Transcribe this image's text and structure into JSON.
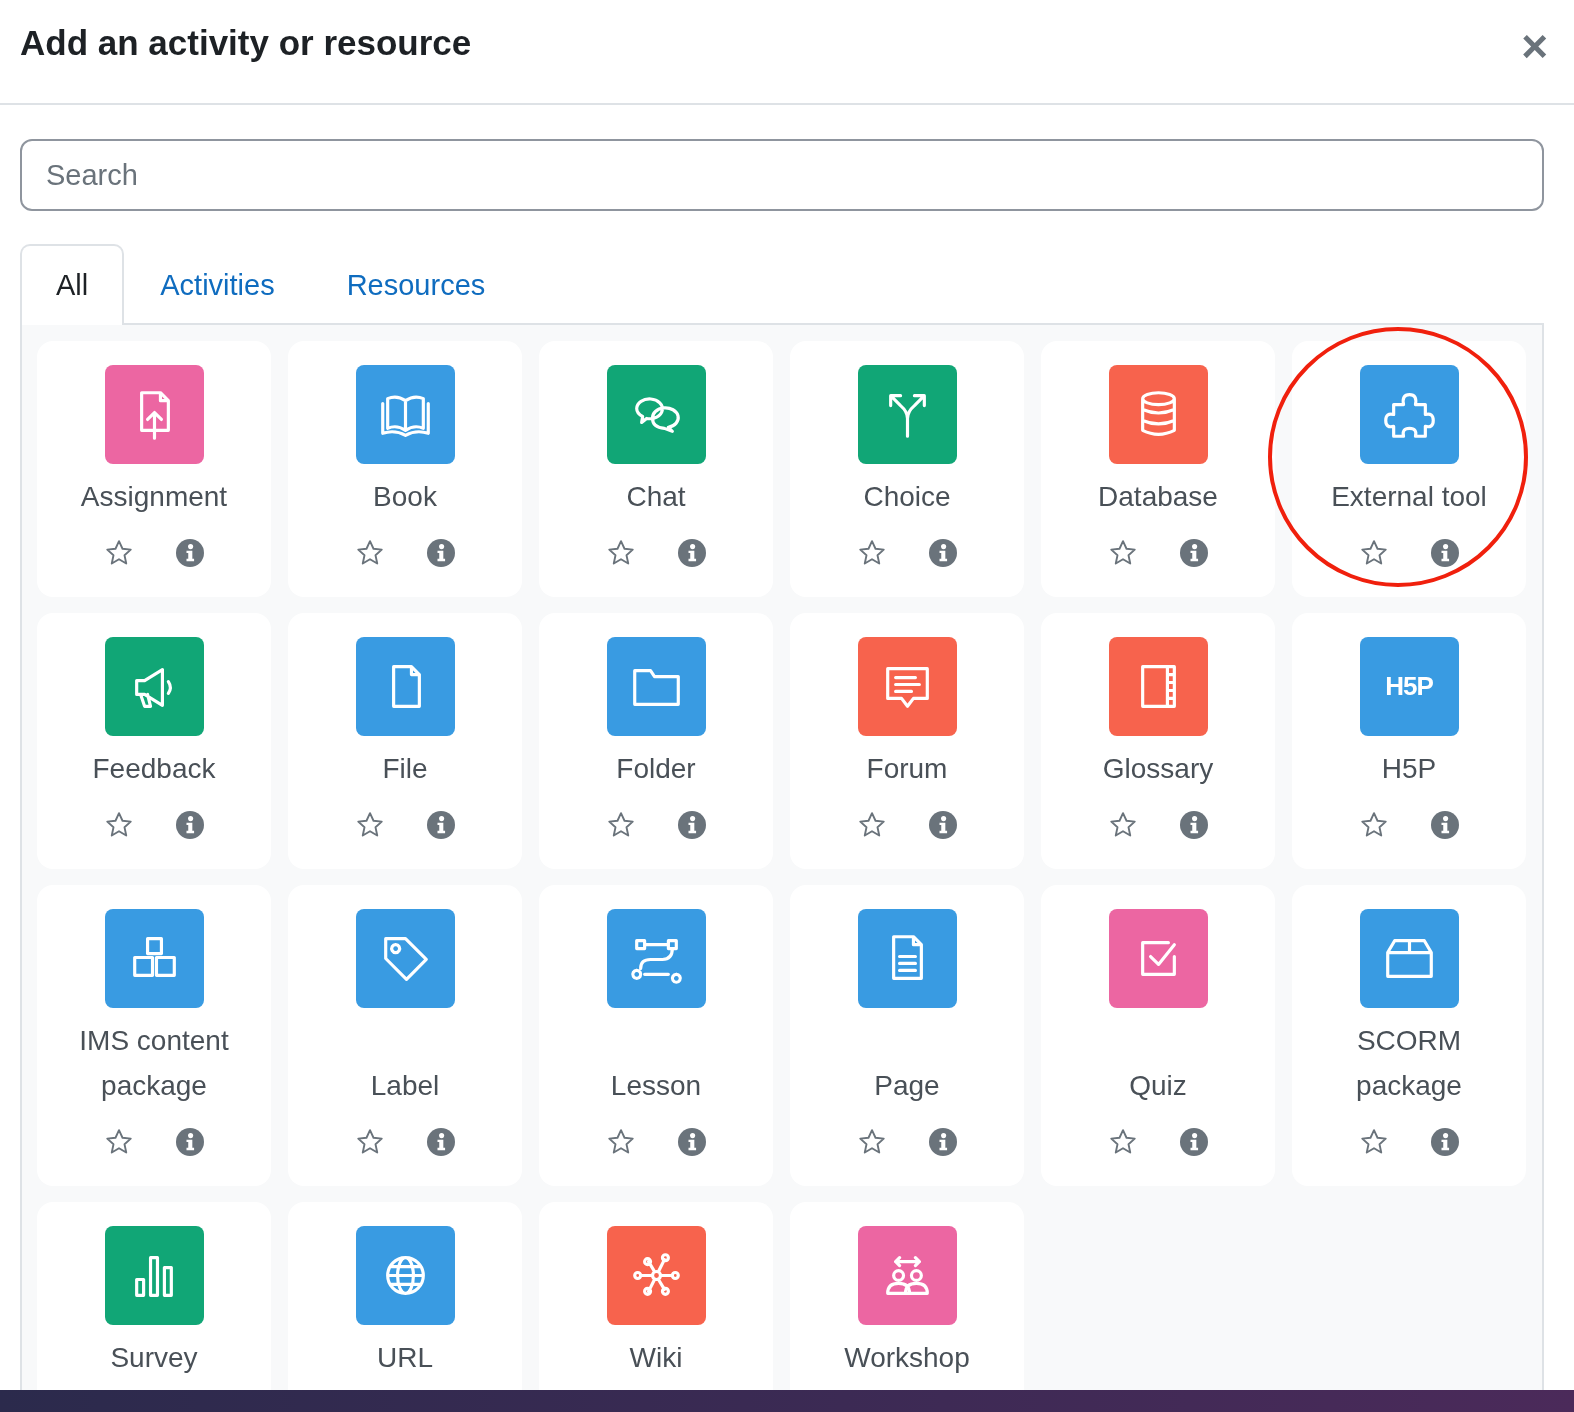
{
  "dialog": {
    "title": "Add an activity or resource",
    "close": "×"
  },
  "search": {
    "placeholder": "Search"
  },
  "tabs": [
    {
      "label": "All",
      "selected": true
    },
    {
      "label": "Activities",
      "selected": false
    },
    {
      "label": "Resources",
      "selected": false
    }
  ],
  "items": [
    {
      "name": "Assignment",
      "color": "#ec66a2",
      "highlighted": false,
      "show_actions": true
    },
    {
      "name": "Book",
      "color": "#399be2",
      "highlighted": false,
      "show_actions": true
    },
    {
      "name": "Chat",
      "color": "#11a676",
      "highlighted": false,
      "show_actions": true
    },
    {
      "name": "Choice",
      "color": "#11a676",
      "highlighted": false,
      "show_actions": true
    },
    {
      "name": "Database",
      "color": "#f7634d",
      "highlighted": false,
      "show_actions": true
    },
    {
      "name": "External tool",
      "color": "#399be2",
      "highlighted": true,
      "show_actions": true
    },
    {
      "name": "Feedback",
      "color": "#11a676",
      "highlighted": false,
      "show_actions": true
    },
    {
      "name": "File",
      "color": "#399be2",
      "highlighted": false,
      "show_actions": true
    },
    {
      "name": "Folder",
      "color": "#399be2",
      "highlighted": false,
      "show_actions": true
    },
    {
      "name": "Forum",
      "color": "#f7634d",
      "highlighted": false,
      "show_actions": true
    },
    {
      "name": "Glossary",
      "color": "#f7634d",
      "highlighted": false,
      "show_actions": true
    },
    {
      "name": "H5P",
      "color": "#399be2",
      "highlighted": false,
      "show_actions": true,
      "icon_text": "H5P"
    },
    {
      "name": "IMS content package",
      "color": "#399be2",
      "highlighted": false,
      "show_actions": true
    },
    {
      "name": "Label",
      "color": "#399be2",
      "highlighted": false,
      "show_actions": true
    },
    {
      "name": "Lesson",
      "color": "#399be2",
      "highlighted": false,
      "show_actions": true
    },
    {
      "name": "Page",
      "color": "#399be2",
      "highlighted": false,
      "show_actions": true
    },
    {
      "name": "Quiz",
      "color": "#ec66a2",
      "highlighted": false,
      "show_actions": true
    },
    {
      "name": "SCORM package",
      "color": "#399be2",
      "highlighted": false,
      "show_actions": true
    },
    {
      "name": "Survey",
      "color": "#11a676",
      "highlighted": false,
      "show_actions": false
    },
    {
      "name": "URL",
      "color": "#399be2",
      "highlighted": false,
      "show_actions": false
    },
    {
      "name": "Wiki",
      "color": "#f7634d",
      "highlighted": false,
      "show_actions": false
    },
    {
      "name": "Workshop",
      "color": "#ec66a2",
      "highlighted": false,
      "show_actions": false
    }
  ]
}
